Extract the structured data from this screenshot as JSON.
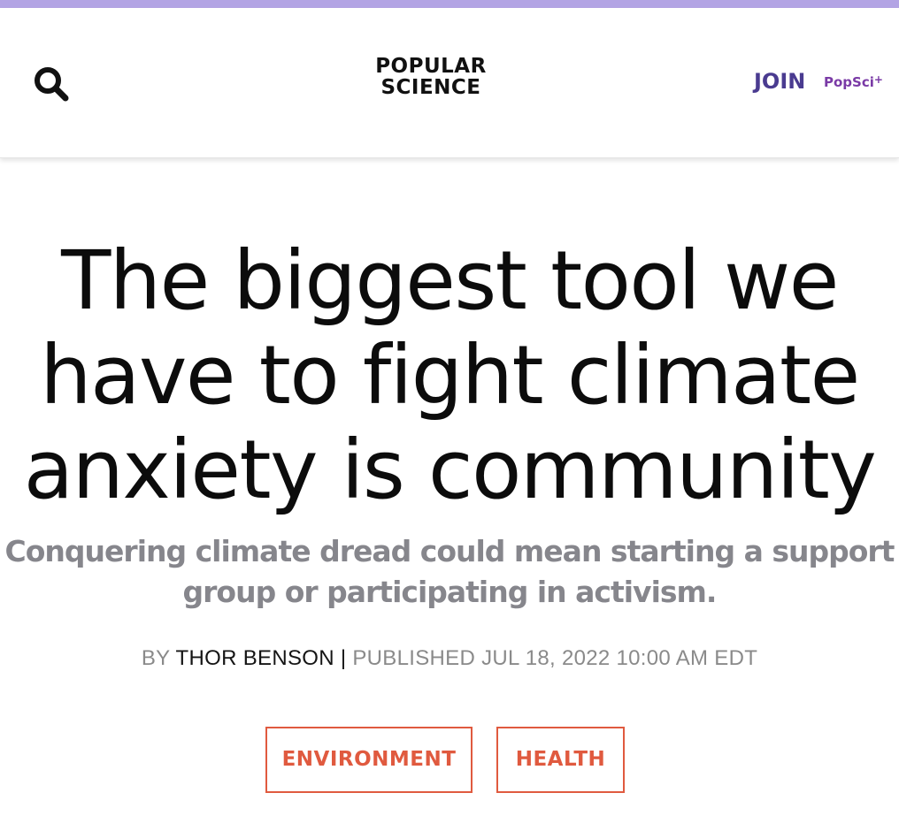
{
  "header": {
    "logo_line1": "POPULAR",
    "logo_line2": "SCIENCE",
    "join_label": "JOIN",
    "popsci_label": "PopSci",
    "popsci_suffix": "+",
    "search_icon": "search-icon",
    "accent_color": "#b3a4e4"
  },
  "article": {
    "headline": "The biggest tool we have to fight climate anxiety is community",
    "dek": "Conquering climate dread could mean starting a support group or participating in activism.",
    "byline_prefix": "BY",
    "author": "THOR BENSON",
    "separator": "|",
    "published": "PUBLISHED JUL 18, 2022 10:00 AM EDT"
  },
  "tags": [
    {
      "label": "ENVIRONMENT"
    },
    {
      "label": "HEALTH"
    }
  ],
  "colors": {
    "tag_accent": "#e05a3f",
    "join": "#4a3b90",
    "popsci": "#7a3aa6",
    "dek": "#86868c"
  }
}
